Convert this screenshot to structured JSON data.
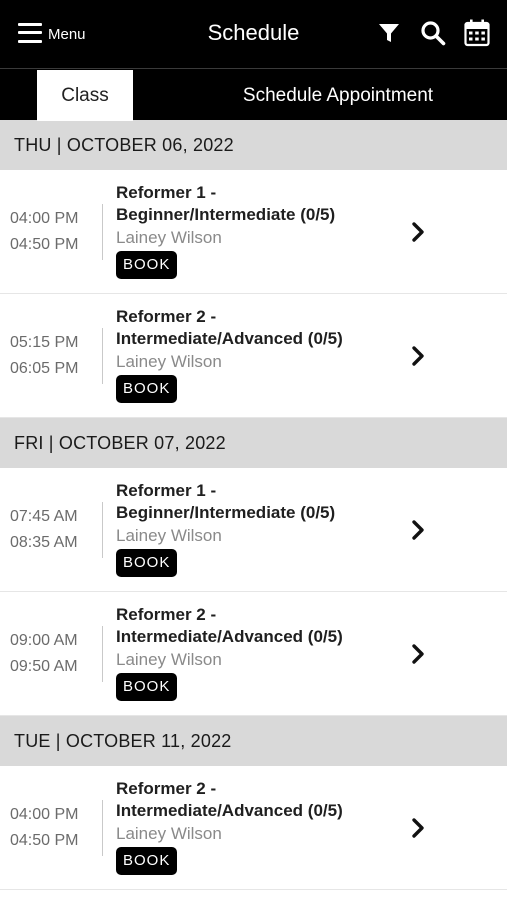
{
  "header": {
    "menu_label": "Menu",
    "title": "Schedule",
    "icons": [
      "filter-icon",
      "search-icon",
      "calendar-icon"
    ]
  },
  "tabs": {
    "class_label": "Class",
    "appointment_label": "Schedule Appointment",
    "active": "Class"
  },
  "book_label": "BOOK",
  "days": [
    {
      "date": "THU | OCTOBER 06, 2022",
      "classes": [
        {
          "start": "04:00 PM",
          "end": "04:50 PM",
          "name_line1": "Reformer 1 -",
          "name_line2": "Beginner/Intermediate (0/5)",
          "instructor": "Lainey Wilson"
        },
        {
          "start": "05:15 PM",
          "end": "06:05 PM",
          "name_line1": "Reformer 2 -",
          "name_line2": "Intermediate/Advanced (0/5)",
          "instructor": "Lainey Wilson"
        }
      ]
    },
    {
      "date": "FRI | OCTOBER 07, 2022",
      "classes": [
        {
          "start": "07:45 AM",
          "end": "08:35 AM",
          "name_line1": "Reformer 1 -",
          "name_line2": "Beginner/Intermediate (0/5)",
          "instructor": "Lainey Wilson"
        },
        {
          "start": "09:00 AM",
          "end": "09:50 AM",
          "name_line1": "Reformer 2 -",
          "name_line2": "Intermediate/Advanced (0/5)",
          "instructor": "Lainey Wilson"
        }
      ]
    },
    {
      "date": "TUE | OCTOBER 11, 2022",
      "classes": [
        {
          "start": "04:00 PM",
          "end": "04:50 PM",
          "name_line1": "Reformer 2 -",
          "name_line2": "Intermediate/Advanced (0/5)",
          "instructor": "Lainey Wilson"
        }
      ]
    }
  ],
  "colors": {
    "header_bg": "#000000",
    "date_header_bg": "#d9d9d9",
    "book_bg": "#000000",
    "time_text": "#6b6b6b",
    "instructor_text": "#8a8a8a"
  }
}
